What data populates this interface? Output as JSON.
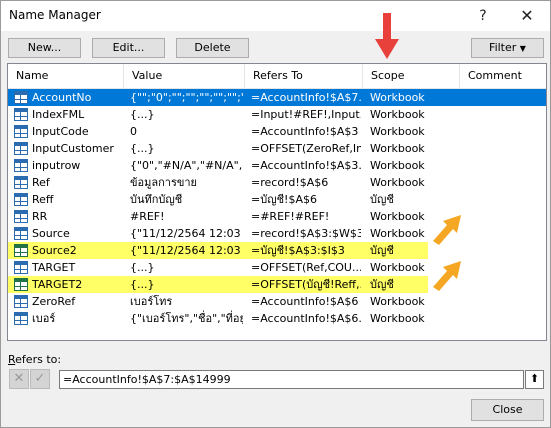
{
  "window": {
    "title": "Name Manager",
    "help_label": "?",
    "close_label": "✕"
  },
  "toolbar": {
    "new_label": "New...",
    "edit_label": "Edit...",
    "delete_label": "Delete",
    "filter_label": "Filter"
  },
  "list": {
    "columns": [
      "Name",
      "Value",
      "Refers To",
      "Scope",
      "Comment"
    ],
    "rows": [
      {
        "name": "AccountNo",
        "value": "{\"\";\"0\";\"\";\"\";\"\";\"\";\"\";\"\";...",
        "refers_to": "=AccountInfo!$A$7...",
        "scope": "Workbook",
        "state": "selected",
        "icon": "table-icon"
      },
      {
        "name": "IndexFML",
        "value": "{...}",
        "refers_to": "=Input!#REF!,Input...",
        "scope": "Workbook",
        "state": "normal",
        "icon": "table-icon"
      },
      {
        "name": "InputCode",
        "value": "0",
        "refers_to": "=AccountInfo!$A$3",
        "scope": "Workbook",
        "state": "normal",
        "icon": "table-icon"
      },
      {
        "name": "InputCustomer",
        "value": "{...}",
        "refers_to": "=OFFSET(ZeroRef,In...",
        "scope": "Workbook",
        "state": "normal",
        "icon": "table-icon"
      },
      {
        "name": "inputrow",
        "value": "{\"0\",\"#N/A\",\"#N/A\",\"...",
        "refers_to": "=AccountInfo!$A$3...",
        "scope": "Workbook",
        "state": "normal",
        "icon": "table-icon"
      },
      {
        "name": "Ref",
        "value": "ข้อมูลการขาย",
        "refers_to": "=record!$A$6",
        "scope": "Workbook",
        "state": "normal",
        "icon": "table-icon"
      },
      {
        "name": "Reff",
        "value": "บันทึกบัญชี",
        "refers_to": "=บัญชี!$A$6",
        "scope": "บัญชี",
        "state": "normal",
        "icon": "table-icon"
      },
      {
        "name": "RR",
        "value": "#REF!",
        "refers_to": "=#REF!#REF!",
        "scope": "Workbook",
        "state": "normal",
        "icon": "table-icon"
      },
      {
        "name": "Source",
        "value": "{\"11/12/2564 12:03 ...",
        "refers_to": "=record!$A$3:$W$3",
        "scope": "Workbook",
        "state": "normal",
        "icon": "table-icon"
      },
      {
        "name": "Source2",
        "value": "{\"11/12/2564 12:03 ...",
        "refers_to": "=บัญชี!$A$3:$I$3",
        "scope": "บัญชี",
        "state": "highlight",
        "icon": "table-icon-green"
      },
      {
        "name": "TARGET",
        "value": "{...}",
        "refers_to": "=OFFSET(Ref,COU...",
        "scope": "Workbook",
        "state": "normal",
        "icon": "table-icon"
      },
      {
        "name": "TARGET2",
        "value": "{...}",
        "refers_to": "=OFFSET(บัญชี!Reff,...",
        "scope": "บัญชี",
        "state": "highlight",
        "icon": "table-icon-green"
      },
      {
        "name": "ZeroRef",
        "value": "เบอร์โทร",
        "refers_to": "=AccountInfo!$A$6",
        "scope": "Workbook",
        "state": "normal",
        "icon": "table-icon"
      },
      {
        "name": "เบอร์",
        "value": "{\"เบอร์โทร\",\"ชื่อ\",\"ที่อยู่...",
        "refers_to": "=AccountInfo!$A$6...",
        "scope": "Workbook",
        "state": "normal",
        "icon": "table-icon"
      }
    ]
  },
  "refers_to": {
    "label_first": "R",
    "label_rest": "efers to:",
    "value": "=AccountInfo!$A$7:$A$14999",
    "cancel_icon": "✕",
    "confirm_icon": "✓",
    "collapse_icon": "⬆"
  },
  "footer": {
    "close_label": "Close"
  },
  "colors": {
    "selected": "#0078d7",
    "highlight": "#ffff66",
    "annotation_red": "#e8403a",
    "annotation_orange": "#f5a623"
  }
}
